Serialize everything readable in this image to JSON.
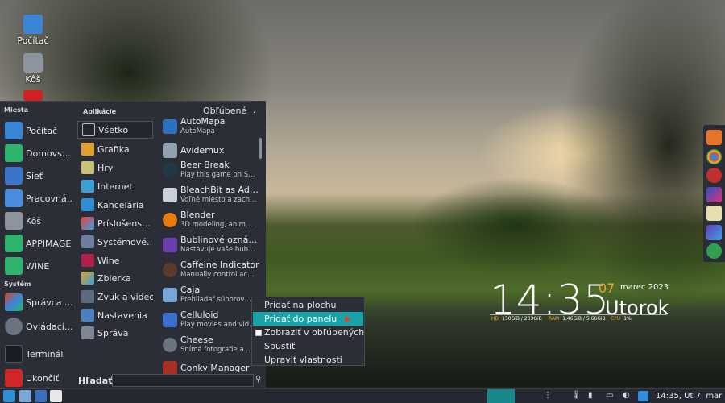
{
  "desktop": {
    "icons": [
      {
        "label": "Počítač"
      },
      {
        "label": "Kôš"
      }
    ]
  },
  "menu": {
    "places_title": "Miesta",
    "system_title": "Systém",
    "places": [
      {
        "label": "Počítač"
      },
      {
        "label": "Domovs…"
      },
      {
        "label": "Sieť"
      },
      {
        "label": "Pracovná…"
      },
      {
        "label": "Kôš"
      },
      {
        "label": "APPIMAGE"
      },
      {
        "label": "WINE"
      }
    ],
    "system": [
      {
        "label": "Správca …"
      },
      {
        "label": "Ovládaci…"
      },
      {
        "label": "Terminál"
      },
      {
        "label": "Ukončiť"
      }
    ],
    "apps_title": "Aplikácie",
    "categories": [
      {
        "label": "Všetko"
      },
      {
        "label": "Grafika"
      },
      {
        "label": "Hry"
      },
      {
        "label": "Internet"
      },
      {
        "label": "Kancelária"
      },
      {
        "label": "Príslušens…"
      },
      {
        "label": "Systémové…"
      },
      {
        "label": "Wine"
      },
      {
        "label": "Zbierka"
      },
      {
        "label": "Zvuk a video"
      },
      {
        "label": "Nastavenia"
      },
      {
        "label": "Správa"
      }
    ],
    "favorites_label": "Obľúbené",
    "favorites_arrow": "›",
    "apps": [
      {
        "name": "AutoMapa",
        "desc": "AutoMapa"
      },
      {
        "name": "Avidemux",
        "desc": ""
      },
      {
        "name": "Beer Break",
        "desc": "Play this game on S…"
      },
      {
        "name": "BleachBit as Ad…",
        "desc": "Voľné miesto a zach…"
      },
      {
        "name": "Blender",
        "desc": "3D modeling, anim…"
      },
      {
        "name": "Bublinové ozná…",
        "desc": "Nastavuje vaše bub…"
      },
      {
        "name": "Caffeine Indicator",
        "desc": "Manually control ac…"
      },
      {
        "name": "Caja",
        "desc": "Prehliadať súborov…"
      },
      {
        "name": "Celluloid",
        "desc": "Play movies and vid…"
      },
      {
        "name": "Cheese",
        "desc": "Snímá fotografie a …"
      },
      {
        "name": "Conky Manager",
        "desc": ""
      }
    ],
    "search_label": "Hľadať:",
    "search_value": "",
    "search_icon": "search-icon"
  },
  "context_menu": {
    "items": [
      {
        "label": "Pridať na plochu"
      },
      {
        "label": "Pridať do panelu"
      },
      {
        "label": "Zobraziť v obľúbených"
      },
      {
        "label": "Spustiť"
      },
      {
        "label": "Upraviť vlastnosti"
      }
    ],
    "highlight_color": "#17a3a8"
  },
  "conky": {
    "time": "14:35",
    "day": "07",
    "month_year": "marec 2023",
    "weekday": "Utorok",
    "hd_label": "HD",
    "hd_value": "150GiB / 233GiB",
    "ram_label": "RAM",
    "ram_value": "1,46GiB / 5,66GiB",
    "cpu_label": "CPU",
    "cpu_value": "1%"
  },
  "panel": {
    "clock": "14:35, Ut  7. mar",
    "tray_icons": [
      "handle-icon",
      "thermometer-icon",
      "network-signal-icon",
      "battery-icon",
      "volume-icon",
      "window-switcher-icon"
    ]
  },
  "colors": {
    "menu_bg": "#2b2e37",
    "accent": "#17a3a8",
    "conky_accent": "#f0a030"
  }
}
